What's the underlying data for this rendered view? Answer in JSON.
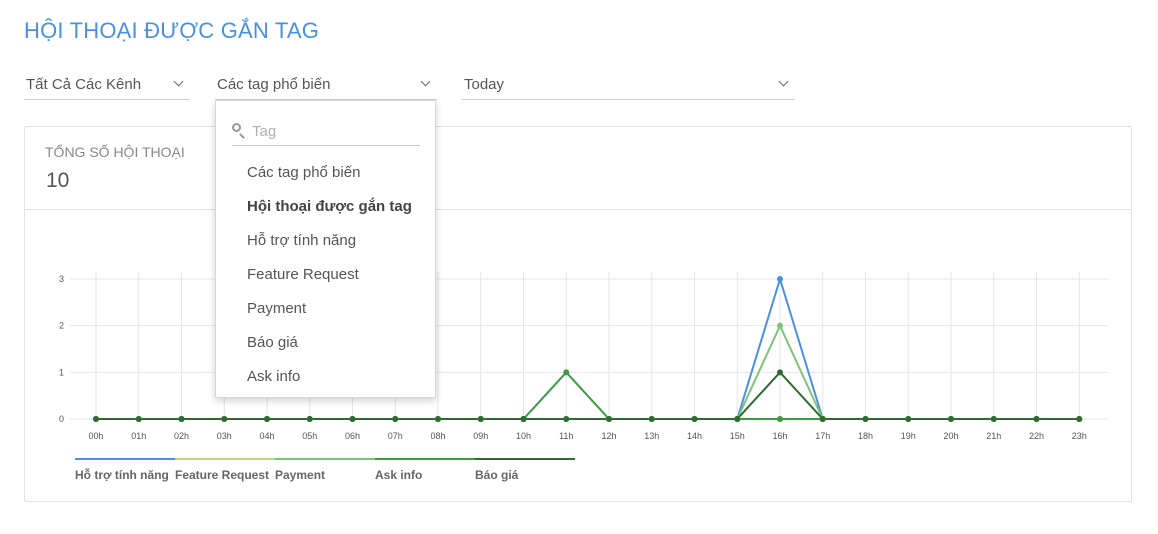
{
  "page": {
    "title": "HỘI THOẠI ĐƯỢC GẮN TAG"
  },
  "filters": {
    "channel": "Tất Cả Các Kênh",
    "tag_group": "Các tag phổ biến",
    "date_range": "Today"
  },
  "dropdown": {
    "search_placeholder": "Tag",
    "options": [
      {
        "label": "Các tag phổ biến",
        "selected": false
      },
      {
        "label": "Hội thoại được gắn tag",
        "selected": true
      },
      {
        "label": "Hỗ trợ tính năng",
        "selected": false
      },
      {
        "label": "Feature Request",
        "selected": false
      },
      {
        "label": "Payment",
        "selected": false
      },
      {
        "label": "Báo giá",
        "selected": false
      },
      {
        "label": "Ask info",
        "selected": false
      }
    ]
  },
  "summary": {
    "label": "TỔNG SỐ HỘI THOẠI",
    "value": "10"
  },
  "colors": {
    "title": "#4a90e2",
    "blue": "#4a90e2",
    "lightgreen": "#b6d97a",
    "green": "#7cc576",
    "midgreen": "#3a9a3e",
    "darkgreen": "#2f6b2f"
  },
  "chart_data": {
    "type": "line",
    "x": [
      "00h",
      "01h",
      "02h",
      "03h",
      "04h",
      "05h",
      "06h",
      "07h",
      "08h",
      "09h",
      "10h",
      "11h",
      "12h",
      "13h",
      "14h",
      "15h",
      "16h",
      "17h",
      "18h",
      "19h",
      "20h",
      "21h",
      "22h",
      "23h"
    ],
    "ylim": [
      0,
      3
    ],
    "yticks": [
      "0",
      "1",
      "2",
      "3"
    ],
    "grid": true,
    "legend_position": "bottom-left",
    "series": [
      {
        "name": "Hỗ trợ tính năng",
        "color": "#4a90e2",
        "values": [
          0,
          0,
          0,
          0,
          0,
          0,
          0,
          0,
          0,
          0,
          0,
          0,
          0,
          0,
          0,
          0,
          3,
          0,
          0,
          0,
          0,
          0,
          0,
          0
        ]
      },
      {
        "name": "Feature Request",
        "color": "#b6d97a",
        "values": [
          0,
          0,
          0,
          0,
          0,
          0,
          0,
          0,
          0,
          0,
          0,
          0,
          0,
          0,
          0,
          0,
          0,
          0,
          0,
          0,
          0,
          0,
          0,
          0
        ]
      },
      {
        "name": "Payment",
        "color": "#7cc576",
        "values": [
          0,
          0,
          0,
          0,
          0,
          0,
          0,
          0,
          0,
          0,
          0,
          0,
          0,
          0,
          0,
          0,
          2,
          0,
          0,
          0,
          0,
          0,
          0,
          0
        ]
      },
      {
        "name": "Ask info",
        "color": "#3a9a3e",
        "values": [
          0,
          0,
          0,
          0,
          0,
          0,
          0,
          0,
          0,
          0,
          0,
          1,
          0,
          0,
          0,
          0,
          0,
          0,
          0,
          0,
          0,
          0,
          0,
          0
        ]
      },
      {
        "name": "Báo giá",
        "color": "#2f6b2f",
        "values": [
          0,
          0,
          0,
          0,
          0,
          0,
          0,
          0,
          0,
          0,
          0,
          0,
          0,
          0,
          0,
          0,
          1,
          0,
          0,
          0,
          0,
          0,
          0,
          0
        ]
      }
    ]
  }
}
